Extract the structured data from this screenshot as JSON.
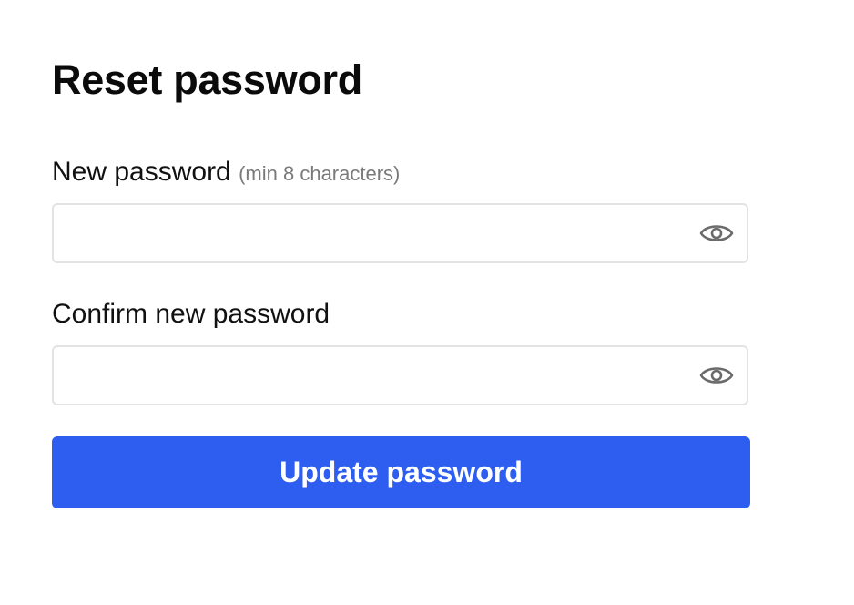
{
  "page": {
    "title": "Reset password"
  },
  "form": {
    "new_password": {
      "label": "New password",
      "hint": "(min 8 characters)",
      "value": "",
      "placeholder": "",
      "toggle_icon": "eye-icon"
    },
    "confirm_password": {
      "label": "Confirm new password",
      "value": "",
      "placeholder": "",
      "toggle_icon": "eye-icon"
    },
    "submit_label": "Update password"
  },
  "colors": {
    "accent": "#2d5ef0",
    "hint_text": "#7a7a7a",
    "input_border": "#e3e3e3",
    "icon": "#6b6b6b"
  }
}
